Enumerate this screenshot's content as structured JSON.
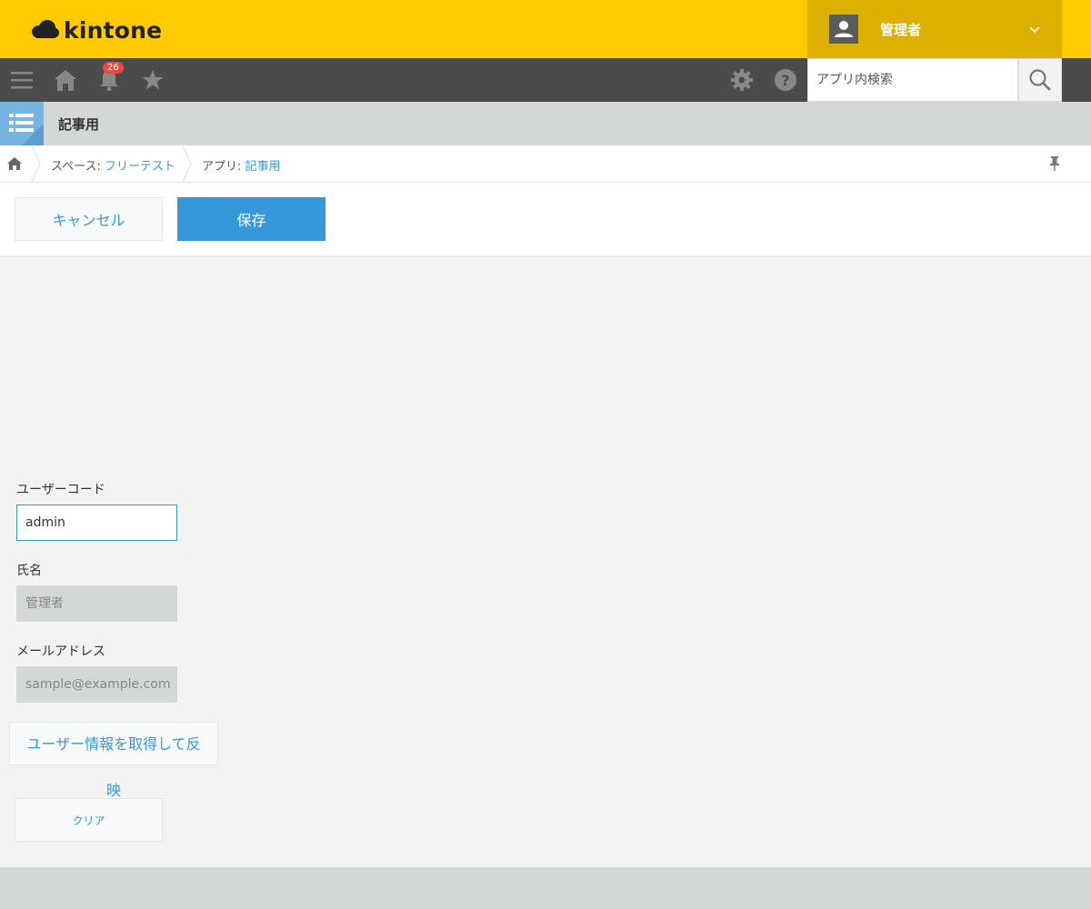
{
  "header": {
    "logo_text": "kintone",
    "user_name": "管理者",
    "accent_color": "#ffca00"
  },
  "toolbar": {
    "icons": [
      "menu-icon",
      "home-icon",
      "bell-icon",
      "star-icon",
      "gear-icon",
      "help-icon"
    ],
    "notification_count": "26",
    "search_placeholder": "アプリ内検索"
  },
  "app": {
    "title": "記事用"
  },
  "breadcrumb": {
    "space_prefix": "スペース: ",
    "space_name": "フリーテスト",
    "app_prefix": "アプリ: ",
    "app_name": "記事用"
  },
  "actions": {
    "cancel_label": "キャンセル",
    "save_label": "保存"
  },
  "form": {
    "user_code_label": "ユーザーコード",
    "user_code_value": "admin",
    "name_label": "氏名",
    "name_placeholder": "管理者",
    "email_label": "メールアドレス",
    "email_placeholder": "sample@example.com",
    "fetch_button_label": "ユーザー情報を取得して反",
    "fetch_button_overflow": "映",
    "clear_button_label": "クリア"
  }
}
